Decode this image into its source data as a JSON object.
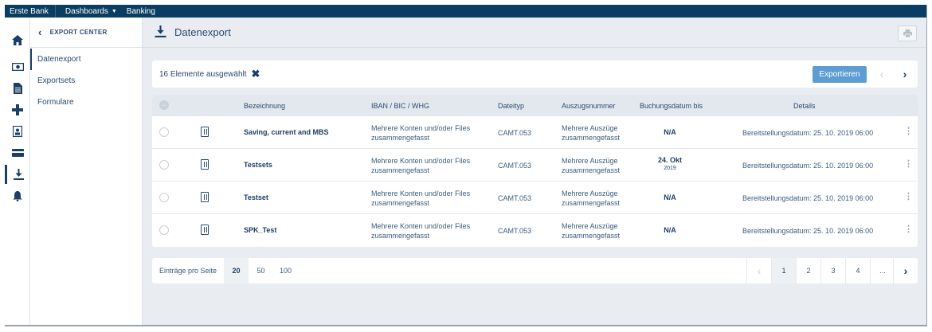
{
  "topbar": {
    "brand": "Erste Bank",
    "dashboards": "Dashboards",
    "banking": "Banking"
  },
  "icons": [
    "home-icon",
    "money-icon",
    "document-icon",
    "plus-icon",
    "contacts-icon",
    "card-icon",
    "download-icon",
    "bell-icon"
  ],
  "secnav": {
    "title": "EXPORT CENTER",
    "items": [
      "Datenexport",
      "Exportsets",
      "Formulare"
    ]
  },
  "page": {
    "title": "Datenexport"
  },
  "actionbar": {
    "selection_text": "16 Elemente ausgewählt",
    "export_label": "Exportieren"
  },
  "table": {
    "headers": [
      "Bezeichnung",
      "IBAN / BIC / WHG",
      "Dateityp",
      "Auszugsnummer",
      "Buchungsdatum bis",
      "Details"
    ],
    "rows": [
      {
        "name": "Saving, current and MBS",
        "iban_1": "Mehrere Konten und/oder Files",
        "iban_2": "zusammengefasst",
        "type": "CAMT.053",
        "stmt_1": "Mehrere Auszüge",
        "stmt_2": "zusammengefasst",
        "date_main": "N/A",
        "date_sub": "",
        "details": "Bereitstellungsdatum: 25. 10. 2019 06:00"
      },
      {
        "name": "Testsets",
        "iban_1": "Mehrere Konten und/oder Files",
        "iban_2": "zusammengefasst",
        "type": "CAMT.053",
        "stmt_1": "Mehrere Auszüge",
        "stmt_2": "zusammengefasst",
        "date_main": "24. Okt",
        "date_sub": "2019",
        "details": "Bereitstellungsdatum: 25. 10. 2019 06:00"
      },
      {
        "name": "Testset",
        "iban_1": "Mehrere Konten und/oder Files",
        "iban_2": "zusammengefasst",
        "type": "CAMT.053",
        "stmt_1": "Mehrere Auszüge",
        "stmt_2": "zusammengefasst",
        "date_main": "N/A",
        "date_sub": "",
        "details": "Bereitstellungsdatum: 25. 10. 2019 06:00"
      },
      {
        "name": "SPK_Test",
        "iban_1": "Mehrere Konten und/oder Files",
        "iban_2": "zusammengefasst",
        "type": "CAMT.053",
        "stmt_1": "Mehrere Auszüge",
        "stmt_2": "zusammengefasst",
        "date_main": "N/A",
        "date_sub": "",
        "details": "Bereitstellungsdatum: 25. 10. 2019 06:00"
      }
    ]
  },
  "pager": {
    "label": "Einträge pro Seite",
    "sizes": [
      "20",
      "50",
      "100"
    ],
    "selected_size": "20",
    "pages": [
      "1",
      "2",
      "3",
      "4",
      "..."
    ],
    "current_page": "1"
  },
  "colors": {
    "topbar": "#0a3d62",
    "accent_button": "#5e9dd1",
    "text": "#2b4a6f",
    "background": "#e9edf2"
  }
}
